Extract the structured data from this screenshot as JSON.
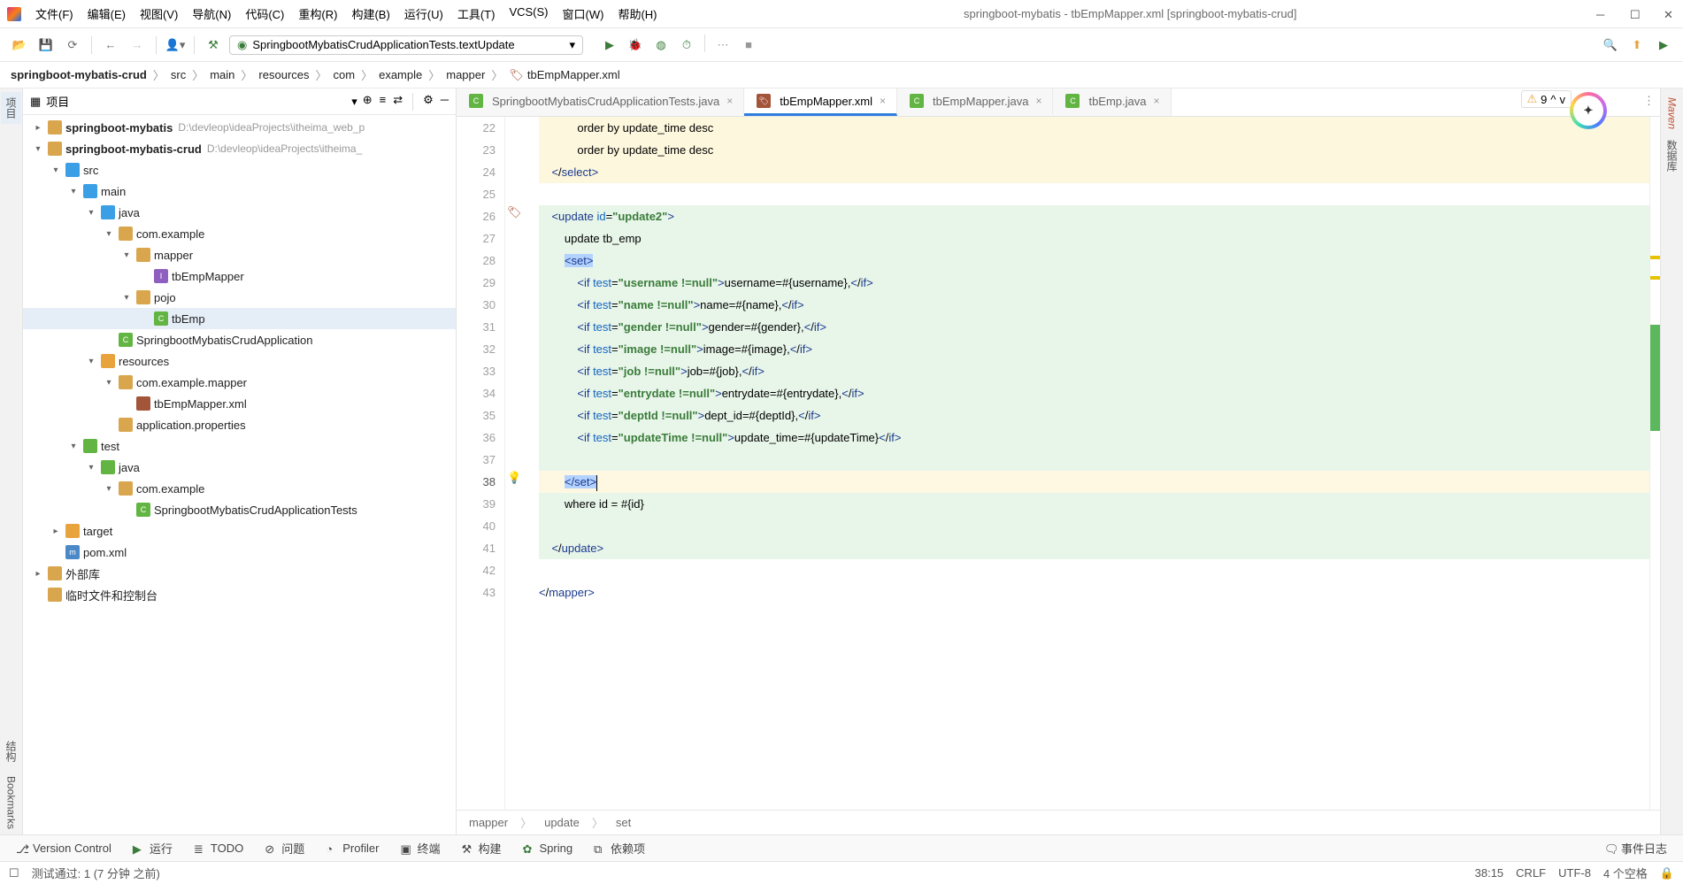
{
  "title_bar": {
    "menus": [
      "文件(F)",
      "编辑(E)",
      "视图(V)",
      "导航(N)",
      "代码(C)",
      "重构(R)",
      "构建(B)",
      "运行(U)",
      "工具(T)",
      "VCS(S)",
      "窗口(W)",
      "帮助(H)"
    ],
    "project_title": "springboot-mybatis - tbEmpMapper.xml [springboot-mybatis-crud]"
  },
  "toolbar": {
    "config_label": "SpringbootMybatisCrudApplicationTests.textUpdate"
  },
  "breadcrumb": [
    "springboot-mybatis-crud",
    "src",
    "main",
    "resources",
    "com",
    "example",
    "mapper",
    "tbEmpMapper.xml"
  ],
  "sidebar": {
    "title": "项目",
    "tree": [
      {
        "depth": 0,
        "arrow": "▸",
        "icon": "folder",
        "label": "springboot-mybatis",
        "path": "D:\\devleop\\ideaProjects\\itheima_web_p"
      },
      {
        "depth": 0,
        "arrow": "▾",
        "icon": "folder",
        "label": "springboot-mybatis-crud",
        "path": "D:\\devleop\\ideaProjects\\itheima_"
      },
      {
        "depth": 1,
        "arrow": "▾",
        "icon": "folder-blue",
        "label": "src"
      },
      {
        "depth": 2,
        "arrow": "▾",
        "icon": "folder-blue",
        "label": "main"
      },
      {
        "depth": 3,
        "arrow": "▾",
        "icon": "folder-blue",
        "label": "java"
      },
      {
        "depth": 4,
        "arrow": "▾",
        "icon": "folder",
        "label": "com.example"
      },
      {
        "depth": 5,
        "arrow": "▾",
        "icon": "folder",
        "label": "mapper"
      },
      {
        "depth": 6,
        "arrow": "",
        "icon": "iface",
        "label": "tbEmpMapper"
      },
      {
        "depth": 5,
        "arrow": "▾",
        "icon": "folder",
        "label": "pojo"
      },
      {
        "depth": 6,
        "arrow": "",
        "icon": "class",
        "label": "tbEmp",
        "selected": true
      },
      {
        "depth": 4,
        "arrow": "",
        "icon": "class",
        "label": "SpringbootMybatisCrudApplication"
      },
      {
        "depth": 3,
        "arrow": "▾",
        "icon": "folder-orange",
        "label": "resources"
      },
      {
        "depth": 4,
        "arrow": "▾",
        "icon": "folder",
        "label": "com.example.mapper"
      },
      {
        "depth": 5,
        "arrow": "",
        "icon": "xml",
        "label": "tbEmpMapper.xml"
      },
      {
        "depth": 4,
        "arrow": "",
        "icon": "folder",
        "label": "application.properties"
      },
      {
        "depth": 2,
        "arrow": "▾",
        "icon": "folder-green",
        "label": "test"
      },
      {
        "depth": 3,
        "arrow": "▾",
        "icon": "folder-green",
        "label": "java"
      },
      {
        "depth": 4,
        "arrow": "▾",
        "icon": "folder",
        "label": "com.example"
      },
      {
        "depth": 5,
        "arrow": "",
        "icon": "class",
        "label": "SpringbootMybatisCrudApplicationTests"
      },
      {
        "depth": 1,
        "arrow": "▸",
        "icon": "folder-orange",
        "label": "target"
      },
      {
        "depth": 1,
        "arrow": "",
        "icon": "m",
        "label": "pom.xml"
      },
      {
        "depth": 0,
        "arrow": "▸",
        "icon": "folder",
        "label": "外部库"
      },
      {
        "depth": 0,
        "arrow": "",
        "icon": "folder",
        "label": "临时文件和控制台"
      }
    ]
  },
  "tabs": [
    {
      "label": "SpringbootMybatisCrudApplicationTests.java",
      "icon": "class",
      "active": false
    },
    {
      "label": "tbEmpMapper.xml",
      "icon": "xml",
      "active": true
    },
    {
      "label": "tbEmpMapper.java",
      "icon": "class",
      "active": false
    },
    {
      "label": "tbEmp.java",
      "icon": "class",
      "active": false
    }
  ],
  "editor": {
    "line_start": 22,
    "line_end": 43,
    "breadcrumb": [
      "mapper",
      "update",
      "set"
    ]
  },
  "code_lines": {
    "l22": {
      "raw": "            order by update_time desc"
    },
    "l23": {
      "raw": "            order by update_time desc"
    },
    "l24": {
      "raw": "    </select>"
    },
    "l25": {
      "raw": ""
    },
    "l26": {
      "raw": "    <update id=\"update2\">"
    },
    "l27": {
      "raw": "        update tb_emp"
    },
    "l28": {
      "raw": "        <set>"
    },
    "l29": {
      "raw": "            <if test=\"username !=null\">username=#{username},</if>"
    },
    "l30": {
      "raw": "            <if test=\"name !=null\">name=#{name},</if>"
    },
    "l31": {
      "raw": "            <if test=\"gender !=null\">gender=#{gender},</if>"
    },
    "l32": {
      "raw": "            <if test=\"image !=null\">image=#{image},</if>"
    },
    "l33": {
      "raw": "            <if test=\"job !=null\">job=#{job},</if>"
    },
    "l34": {
      "raw": "            <if test=\"entrydate !=null\">entrydate=#{entrydate},</if>"
    },
    "l35": {
      "raw": "            <if test=\"deptId !=null\">dept_id=#{deptId},</if>"
    },
    "l36": {
      "raw": "            <if test=\"updateTime !=null\">update_time=#{updateTime}</if>"
    },
    "l37": {
      "raw": ""
    },
    "l38": {
      "raw": "        </set>"
    },
    "l39": {
      "raw": "        where id = #{id}"
    },
    "l40": {
      "raw": ""
    },
    "l41": {
      "raw": "    </update>"
    },
    "l42": {
      "raw": ""
    },
    "l43": {
      "raw": "</mapper>"
    }
  },
  "warn": {
    "count": "9"
  },
  "bottom_tools": [
    "Version Control",
    "运行",
    "TODO",
    "问题",
    "Profiler",
    "终端",
    "构建",
    "Spring",
    "依赖项"
  ],
  "bottom_right": "事件日志",
  "status": {
    "left": "测试通过: 1 (7 分钟 之前)",
    "pos": "38:15",
    "eol": "CRLF",
    "enc": "UTF-8",
    "tail": "4 个空格"
  },
  "left_tabs": [
    "项目",
    "结构",
    "Bookmarks"
  ],
  "right_tabs": [
    "Maven",
    "数据库"
  ]
}
